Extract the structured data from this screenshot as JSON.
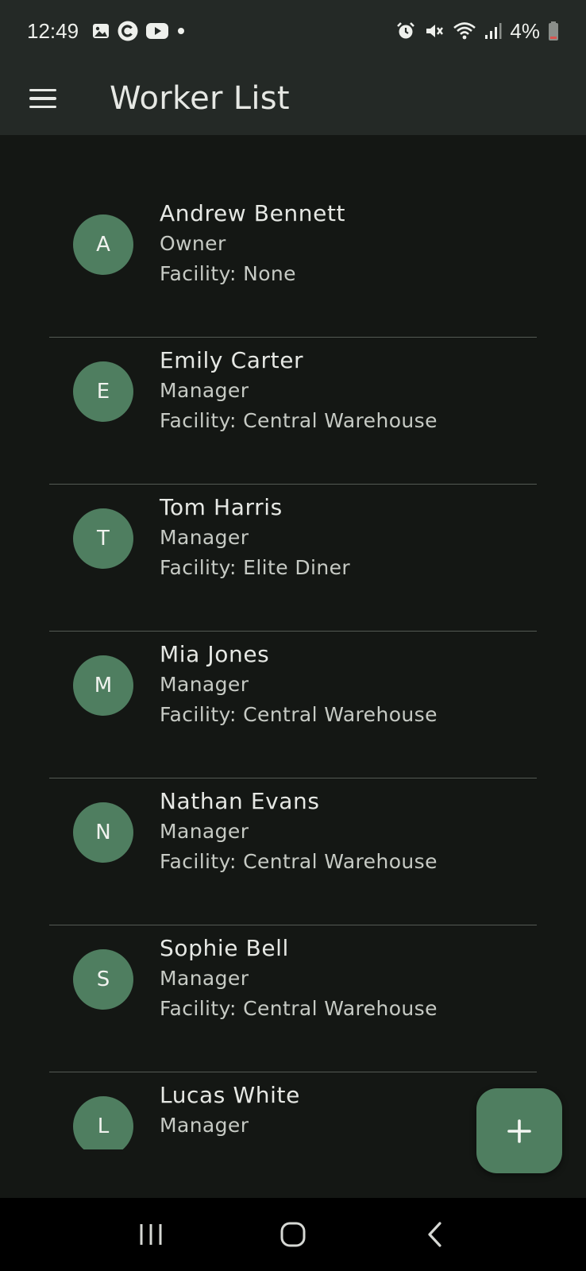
{
  "status_bar": {
    "time": "12:49",
    "battery": "4%"
  },
  "app_bar": {
    "title": "Worker List"
  },
  "workers": [
    {
      "initial": "A",
      "name": "Andrew Bennett",
      "role": "Owner",
      "facility": "Facility: None"
    },
    {
      "initial": "E",
      "name": "Emily Carter",
      "role": "Manager",
      "facility": "Facility: Central Warehouse"
    },
    {
      "initial": "T",
      "name": "Tom Harris",
      "role": "Manager",
      "facility": "Facility: Elite Diner"
    },
    {
      "initial": "M",
      "name": "Mia Jones",
      "role": "Manager",
      "facility": "Facility: Central Warehouse"
    },
    {
      "initial": "N",
      "name": "Nathan Evans",
      "role": "Manager",
      "facility": "Facility: Central Warehouse"
    },
    {
      "initial": "S",
      "name": "Sophie Bell",
      "role": "Manager",
      "facility": "Facility: Central Warehouse"
    },
    {
      "initial": "L",
      "name": "Lucas White",
      "role": "Manager",
      "facility": ""
    }
  ],
  "icons": {
    "menu": "hamburger-menu-icon",
    "fab": "plus-icon",
    "nav_recents": "recents-icon",
    "nav_home": "home-icon",
    "nav_back": "back-icon"
  },
  "colors": {
    "background": "#141714",
    "app_bar": "#242926",
    "accent": "#4f7e60",
    "divider": "#545a54"
  }
}
